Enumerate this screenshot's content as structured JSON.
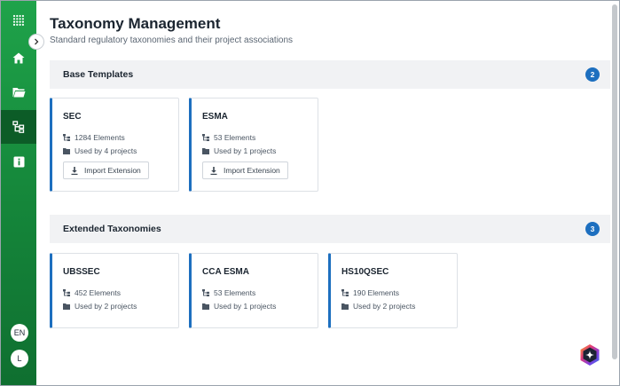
{
  "header": {
    "title": "Taxonomy Management",
    "subtitle": "Standard regulatory taxonomies and their project associations"
  },
  "sidebar": {
    "items": [
      {
        "icon": "apps-grid-icon"
      },
      {
        "icon": "home-icon"
      },
      {
        "icon": "folder-icon"
      },
      {
        "icon": "taxonomy-tree-icon",
        "active": true
      },
      {
        "icon": "info-icon"
      }
    ],
    "language": "EN",
    "user_initial": "L"
  },
  "base_templates": {
    "title": "Base Templates",
    "count": "2",
    "cards": [
      {
        "name": "SEC",
        "elements": "1284 Elements",
        "usage": "Used by 4 projects",
        "action": "Import Extension"
      },
      {
        "name": "ESMA",
        "elements": "53 Elements",
        "usage": "Used by 1 projects",
        "action": "Import Extension"
      }
    ]
  },
  "extended_taxonomies": {
    "title": "Extended Taxonomies",
    "count": "3",
    "cards": [
      {
        "name": "UBSSEC",
        "elements": "452 Elements",
        "usage": "Used by 2 projects"
      },
      {
        "name": "CCA ESMA",
        "elements": "53 Elements",
        "usage": "Used by 1 projects"
      },
      {
        "name": "HS10QSEC",
        "elements": "190 Elements",
        "usage": "Used by 2 projects"
      }
    ]
  },
  "colors": {
    "sidebar_green": "#1fa34a",
    "accent_blue": "#1d6fbf",
    "section_bg": "#f1f2f4"
  }
}
